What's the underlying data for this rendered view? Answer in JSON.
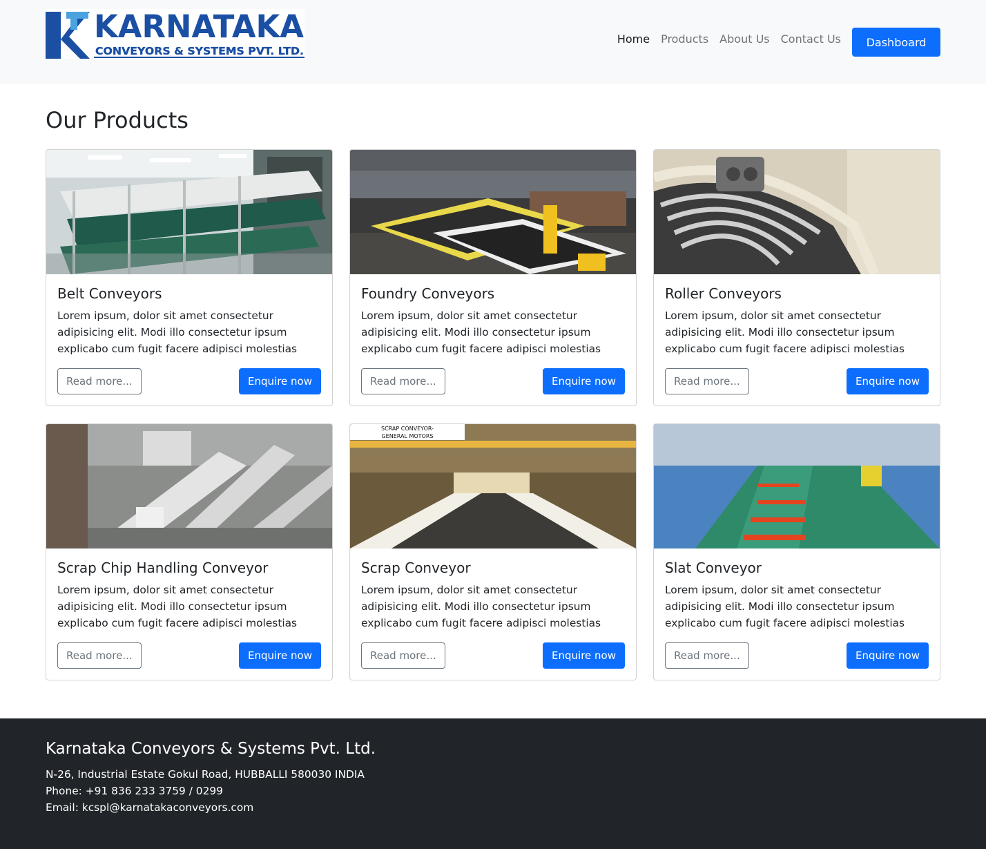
{
  "brand": {
    "logo_line1": "KARNATAKA",
    "logo_line2": "CONVEYORS & SYSTEMS PVT. LTD."
  },
  "nav": {
    "links": [
      "Home",
      "Products",
      "About Us",
      "Contact Us"
    ],
    "active": "Home",
    "dashboard_label": "Dashboard"
  },
  "page": {
    "title": "Our Products"
  },
  "products": [
    {
      "title": "Belt Conveyors",
      "text": "Lorem ipsum, dolor sit amet consectetur adipisicing elit. Modi illo consectetur ipsum explicabo cum fugit facere adipisci molestias mollitia aspernatu...",
      "read_more": "Read more...",
      "enquire": "Enquire now"
    },
    {
      "title": "Foundry Conveyors",
      "text": "Lorem ipsum, dolor sit amet consectetur adipisicing elit. Modi illo consectetur ipsum explicabo cum fugit facere adipisci molestias mollitia aspernatu...",
      "read_more": "Read more...",
      "enquire": "Enquire now"
    },
    {
      "title": "Roller Conveyors",
      "text": "Lorem ipsum, dolor sit amet consectetur adipisicing elit. Modi illo consectetur ipsum explicabo cum fugit facere adipisci molestias mollitia aspernatu...",
      "read_more": "Read more...",
      "enquire": "Enquire now"
    },
    {
      "title": "Scrap Chip Handling Conveyor",
      "text": "Lorem ipsum, dolor sit amet consectetur adipisicing elit. Modi illo consectetur ipsum explicabo cum fugit facere adipisci molestias mollitia aspernatu...",
      "read_more": "Read more...",
      "enquire": "Enquire now"
    },
    {
      "title": "Scrap Conveyor",
      "text": "Lorem ipsum, dolor sit amet consectetur adipisicing elit. Modi illo consectetur ipsum explicabo cum fugit facere adipisci molestias mollitia aspernatu...",
      "read_more": "Read more...",
      "enquire": "Enquire now",
      "image_caption_line1": "SCRAP CONVEYOR-",
      "image_caption_line2": "GENERAL MOTORS"
    },
    {
      "title": "Slat Conveyor",
      "text": "Lorem ipsum, dolor sit amet consectetur adipisicing elit. Modi illo consectetur ipsum explicabo cum fugit facere adipisci molestias mollitia aspernatu...",
      "read_more": "Read more...",
      "enquire": "Enquire now"
    }
  ],
  "footer": {
    "company": "Karnataka Conveyors & Systems Pvt. Ltd.",
    "address": "N-26, Industrial Estate Gokul Road, HUBBALLI 580030 INDIA",
    "phone": "Phone: +91 836 233 3759 / 0299",
    "email": "Email: kcspl@karnatakaconveyors.com"
  },
  "colors": {
    "primary": "#0d6efd",
    "secondary": "#6c757d",
    "navbar_bg": "#f8f9fa",
    "footer_bg": "#212529",
    "logo_blue": "#1a4fa3"
  }
}
